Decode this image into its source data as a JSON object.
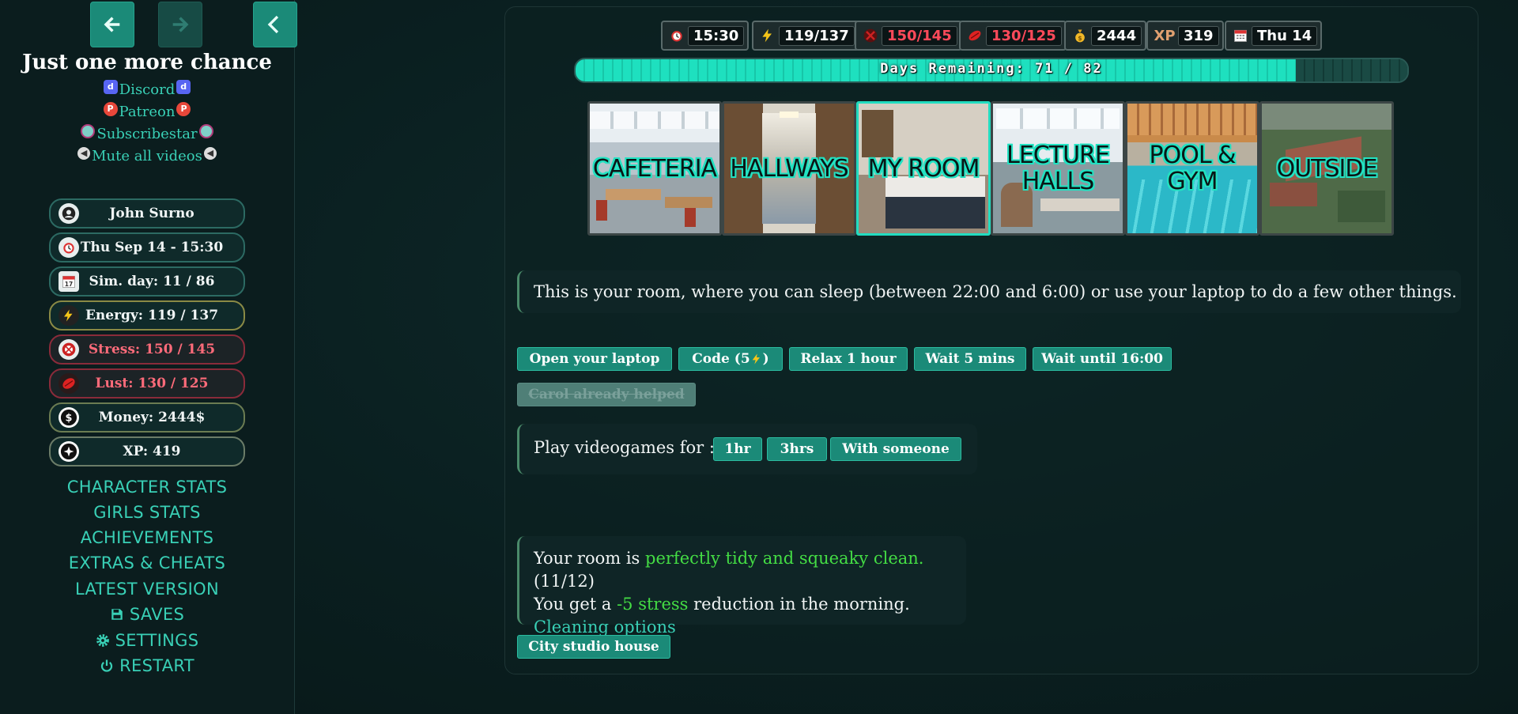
{
  "sidebar": {
    "title": "Just one more chance",
    "links": {
      "discord": "Discord",
      "patreon": "Patreon",
      "subscribestar": "Subscribestar",
      "mute": "Mute all videos"
    },
    "stats": {
      "name": "John Surno",
      "datetime": "Thu Sep 14 - 15:30",
      "sim_day": "Sim. day: 11 / 86",
      "energy": "Energy: 119 / 137",
      "stress": "Stress: 150 / 145",
      "lust": "Lust: 130 / 125",
      "money": "Money: 2444$",
      "xp": "XP: 419"
    },
    "menu": {
      "character_stats": "CHARACTER STATS",
      "girls_stats": "GIRLS STATS",
      "achievements": "ACHIEVEMENTS",
      "extras": "EXTRAS & CHEATS",
      "latest": "LATEST VERSION",
      "saves": "SAVES",
      "settings": "SETTINGS",
      "restart": "RESTART"
    }
  },
  "topbar": {
    "time": "15:30",
    "energy": "119/137",
    "stress": "150/145",
    "lust": "130/125",
    "money": "2444",
    "xp_label": "XP",
    "xp": "319",
    "day": "Thu 14"
  },
  "days": {
    "label": "Days Remaining: 71 / 82",
    "remaining": 71,
    "total": 82
  },
  "locations": [
    {
      "label": "CAFETERIA"
    },
    {
      "label": "HALLWAYS"
    },
    {
      "label": "MY ROOM"
    },
    {
      "label": "LECTURE HALLS"
    },
    {
      "label": "POOL & GYM"
    },
    {
      "label": "OUTSIDE"
    }
  ],
  "room": {
    "description": "This is your room, where you can sleep (between 22:00 and 6:00) or use your laptop to do a few other things.",
    "actions": {
      "open_laptop": "Open your laptop",
      "code_prefix": "Code (5",
      "code_suffix": ")",
      "relax": "Relax 1 hour",
      "wait5": "Wait 5 mins",
      "wait_until": "Wait until 16:00",
      "carol": "Carol already helped"
    },
    "games": {
      "label": "Play videogames for :",
      "opt1": "1hr",
      "opt2": "3hrs",
      "opt3": "With someone"
    },
    "cleanliness": {
      "prefix": "Your room is ",
      "state": "perfectly tidy and squeaky clean.",
      "score": "(11/12)",
      "line2_prefix": "You get a ",
      "stress_bonus": "-5 stress",
      "line2_suffix": " reduction in the morning.",
      "options": "Cleaning options"
    },
    "studio": "City studio house"
  }
}
